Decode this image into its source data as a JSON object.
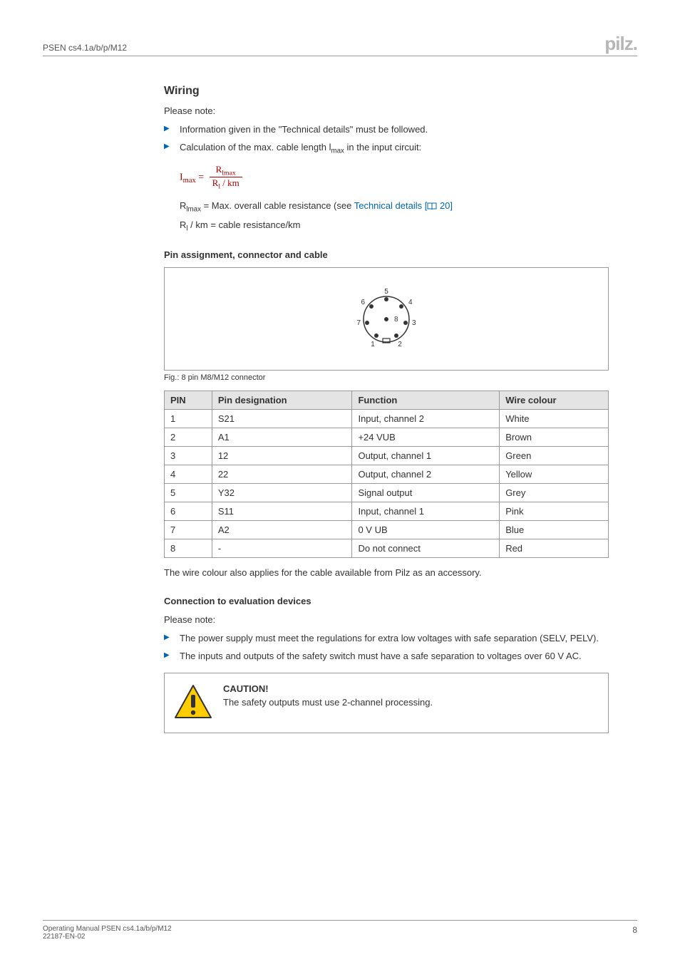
{
  "header": {
    "product": "PSEN cs4.1a/b/p/M12",
    "logo_text": "pilz"
  },
  "wiring": {
    "title": "Wiring",
    "intro": "Please note:",
    "bullets": [
      "Information given in the \"Technical details\" must be followed.",
      "Calculation of the max. cable length l"
    ],
    "bullet2_sub": "max",
    "bullet2_tail": " in the input circuit:",
    "formula": {
      "left": "I",
      "left_sub": "max",
      "eq": " = ",
      "num_base": "R",
      "num_sub": "lmax",
      "den_base": "R",
      "den_sub": "l",
      "den_tail": " / km"
    },
    "r_lmax_line_a": "R",
    "r_lmax_sub": "lmax",
    "r_lmax_line_b": " = Max. overall cable resistance (see ",
    "tech_link_text": "Technical details [",
    "tech_link_page": " 20]",
    "r_l_line_a": "R",
    "r_l_sub": "l",
    "r_l_line_b": " / km = cable resistance/km"
  },
  "pin_section": {
    "heading": "Pin assignment, connector and cable",
    "caption": "Fig.: 8 pin M8/M12 connector",
    "pin_labels": {
      "p1": "1",
      "p2": "2",
      "p3": "3",
      "p4": "4",
      "p5": "5",
      "p6": "6",
      "p7": "7",
      "p8": "8"
    },
    "columns": {
      "pin": "PIN",
      "desig": "Pin designation",
      "func": "Function",
      "colour": "Wire colour"
    },
    "rows": [
      {
        "pin": "1",
        "desig": "S21",
        "func": "Input, channel 2",
        "colour": "White"
      },
      {
        "pin": "2",
        "desig": "A1",
        "func": "+24 VUB",
        "colour": "Brown"
      },
      {
        "pin": "3",
        "desig": "12",
        "func": "Output, channel 1",
        "colour": "Green"
      },
      {
        "pin": "4",
        "desig": "22",
        "func": "Output, channel 2",
        "colour": "Yellow"
      },
      {
        "pin": "5",
        "desig": "Y32",
        "func": "Signal output",
        "colour": "Grey"
      },
      {
        "pin": "6",
        "desig": "S11",
        "func": "Input, channel 1",
        "colour": "Pink"
      },
      {
        "pin": "7",
        "desig": "A2",
        "func": "0 V UB",
        "colour": "Blue"
      },
      {
        "pin": "8",
        "desig": "-",
        "func": "Do not connect",
        "colour": "Red"
      }
    ],
    "note_after": "The wire colour also applies for the cable available from Pilz as an accessory."
  },
  "conn_section": {
    "heading": "Connection to evaluation devices",
    "intro": "Please note:",
    "bullets": [
      "The power supply must meet the regulations for extra low voltages with safe separation (SELV, PELV).",
      "The inputs and outputs of the safety switch must have a safe separation to voltages over 60 V AC."
    ]
  },
  "caution": {
    "title": "CAUTION!",
    "body": "The safety outputs must use 2-channel processing."
  },
  "footer": {
    "line1": "Operating Manual PSEN cs4.1a/b/p/M12",
    "line2": "22187-EN-02",
    "page": "8"
  },
  "chart_data": {
    "type": "table",
    "title": "Pin assignment, connector and cable",
    "columns": [
      "PIN",
      "Pin designation",
      "Function",
      "Wire colour"
    ],
    "rows": [
      [
        "1",
        "S21",
        "Input, channel 2",
        "White"
      ],
      [
        "2",
        "A1",
        "+24 VUB",
        "Brown"
      ],
      [
        "3",
        "12",
        "Output, channel 1",
        "Green"
      ],
      [
        "4",
        "22",
        "Output, channel 2",
        "Yellow"
      ],
      [
        "5",
        "Y32",
        "Signal output",
        "Grey"
      ],
      [
        "6",
        "S11",
        "Input, channel 1",
        "Pink"
      ],
      [
        "7",
        "A2",
        "0 V UB",
        "Blue"
      ],
      [
        "8",
        "-",
        "Do not connect",
        "Red"
      ]
    ]
  }
}
